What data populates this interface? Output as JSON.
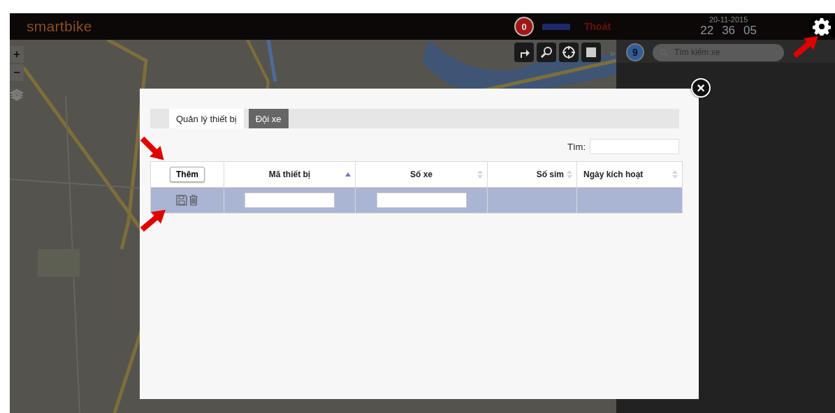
{
  "header": {
    "logo": "smartbike",
    "alert_count": "0",
    "logout": "Thoát",
    "date": "20-11-2015",
    "time": [
      "22",
      "36",
      "05"
    ]
  },
  "map": {
    "zoom_in": "+",
    "zoom_out": "−"
  },
  "toolbar": {
    "more": "»",
    "vehicle_count": "9",
    "search": {
      "placeholder": "Tìm kiếm xe"
    }
  },
  "modal": {
    "close": "×",
    "tabs": [
      {
        "label": "Quản lý thiết bị",
        "selected": true
      },
      {
        "label": "Đội xe",
        "selected": false
      }
    ],
    "search_label": "Tìm:",
    "add_button": "Thêm",
    "columns": [
      {
        "label": "Mã thiết bị",
        "sorted_ascending": true
      },
      {
        "label": "Số xe",
        "sorted_ascending": false
      },
      {
        "label": "Số sim",
        "sorted_ascending": false
      },
      {
        "label": "Ngày kích hoạt",
        "sorted_ascending": false
      }
    ],
    "rows": [
      {
        "selected": true,
        "cells": [
          {
            "kind": "input"
          },
          {
            "kind": "input"
          },
          {
            "kind": "empty"
          },
          {
            "kind": "empty"
          }
        ]
      }
    ]
  }
}
